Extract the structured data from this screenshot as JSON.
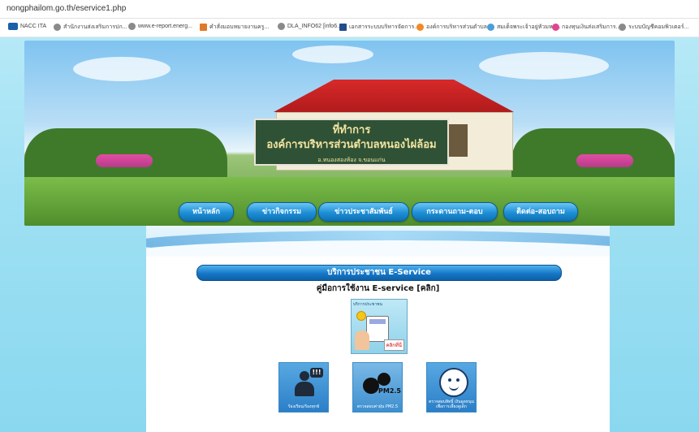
{
  "browser": {
    "url": "nongphailom.go.th/eservice1.php",
    "bookmarks": [
      {
        "label": "NACC ITA",
        "icon": "nacc-logo-icon"
      },
      {
        "label": "สำนักงานส่งเสริมการปก...",
        "icon": "globe-icon"
      },
      {
        "label": "www.e-report.energ...",
        "icon": "globe-icon"
      },
      {
        "label": "คำสั่งมอบหมายงานครู...",
        "icon": "document-icon"
      },
      {
        "label": "DLA_INFO62 [info6...",
        "icon": "globe-icon"
      },
      {
        "label": "เอกสารระบบบริหารจัดการ...",
        "icon": "document-icon"
      },
      {
        "label": "องค์การบริหารส่วนตำบล...",
        "icon": "seal-icon"
      },
      {
        "label": "สมเด็จพระเจ้าอยู่หัวมหา...",
        "icon": "seal-icon"
      },
      {
        "label": "กองทุนเงินส่งเสริมการ...",
        "icon": "seal-icon"
      },
      {
        "label": "ระบบบัญชีคอมพิวเตอร์...",
        "icon": "globe-icon"
      }
    ]
  },
  "banner": {
    "sign_title": "ที่ทำการ",
    "sign_name": "องค์การบริหารส่วนตำบลหนองไผ่ล้อม",
    "sign_sub": "อ.หนองสองห้อง    จ.ขอนแก่น"
  },
  "nav": {
    "items": [
      "หน้าหลัก",
      "ข่าวกิจกรรม",
      "ข่าวประชาสัมพันธ์",
      "กระดานถาม-ตอบ",
      "ติดต่อ-สอบถาม"
    ]
  },
  "content": {
    "title": "บริการประชาชน E-Service",
    "manual_link": "คู่มือการใช้งาน E-service [คลิก]",
    "manual_image_caption": "บริการประชาชน",
    "manual_image_click": "คลิกที่นี่",
    "services": [
      {
        "label": "ร้องเรียน/ร้องทุกข์",
        "icon": "complaint-person-icon"
      },
      {
        "label": "ตรวจสอบค่าฝุ่น PM2.5",
        "icon": "pm25-icon",
        "icon_text": "PM2.5"
      },
      {
        "label": "ตรวจสอบสิทธิ์ เงินอุดหนุนเพื่อการเลี้ยงดูเด็ก",
        "icon": "baby-face-icon"
      }
    ]
  },
  "colors": {
    "nav_button": "#1d8fd6",
    "page_background": "#9fe0f3",
    "roof": "#d8292a"
  }
}
